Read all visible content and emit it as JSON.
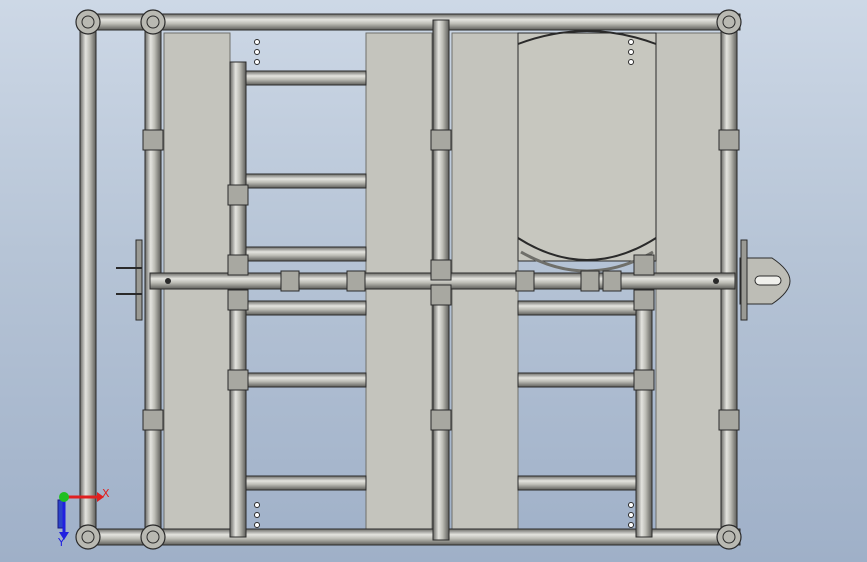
{
  "view": {
    "background_top": "#cdd8e6",
    "background_bottom": "#9fb0c8"
  },
  "colors": {
    "tube": "#b9b9b2",
    "tube_dark": "#5c5c58",
    "tube_light": "#e6e6e1",
    "panel": "#c4c4bd",
    "panel_edge": "#6f6f6a",
    "drum": "#c7c7bf",
    "edge": "#2a2a2a"
  },
  "triad": {
    "x_label": "X",
    "y_label": "Y",
    "x_color": "#e02020",
    "y_color": "#2020e0",
    "origin_color": "#20c020"
  }
}
